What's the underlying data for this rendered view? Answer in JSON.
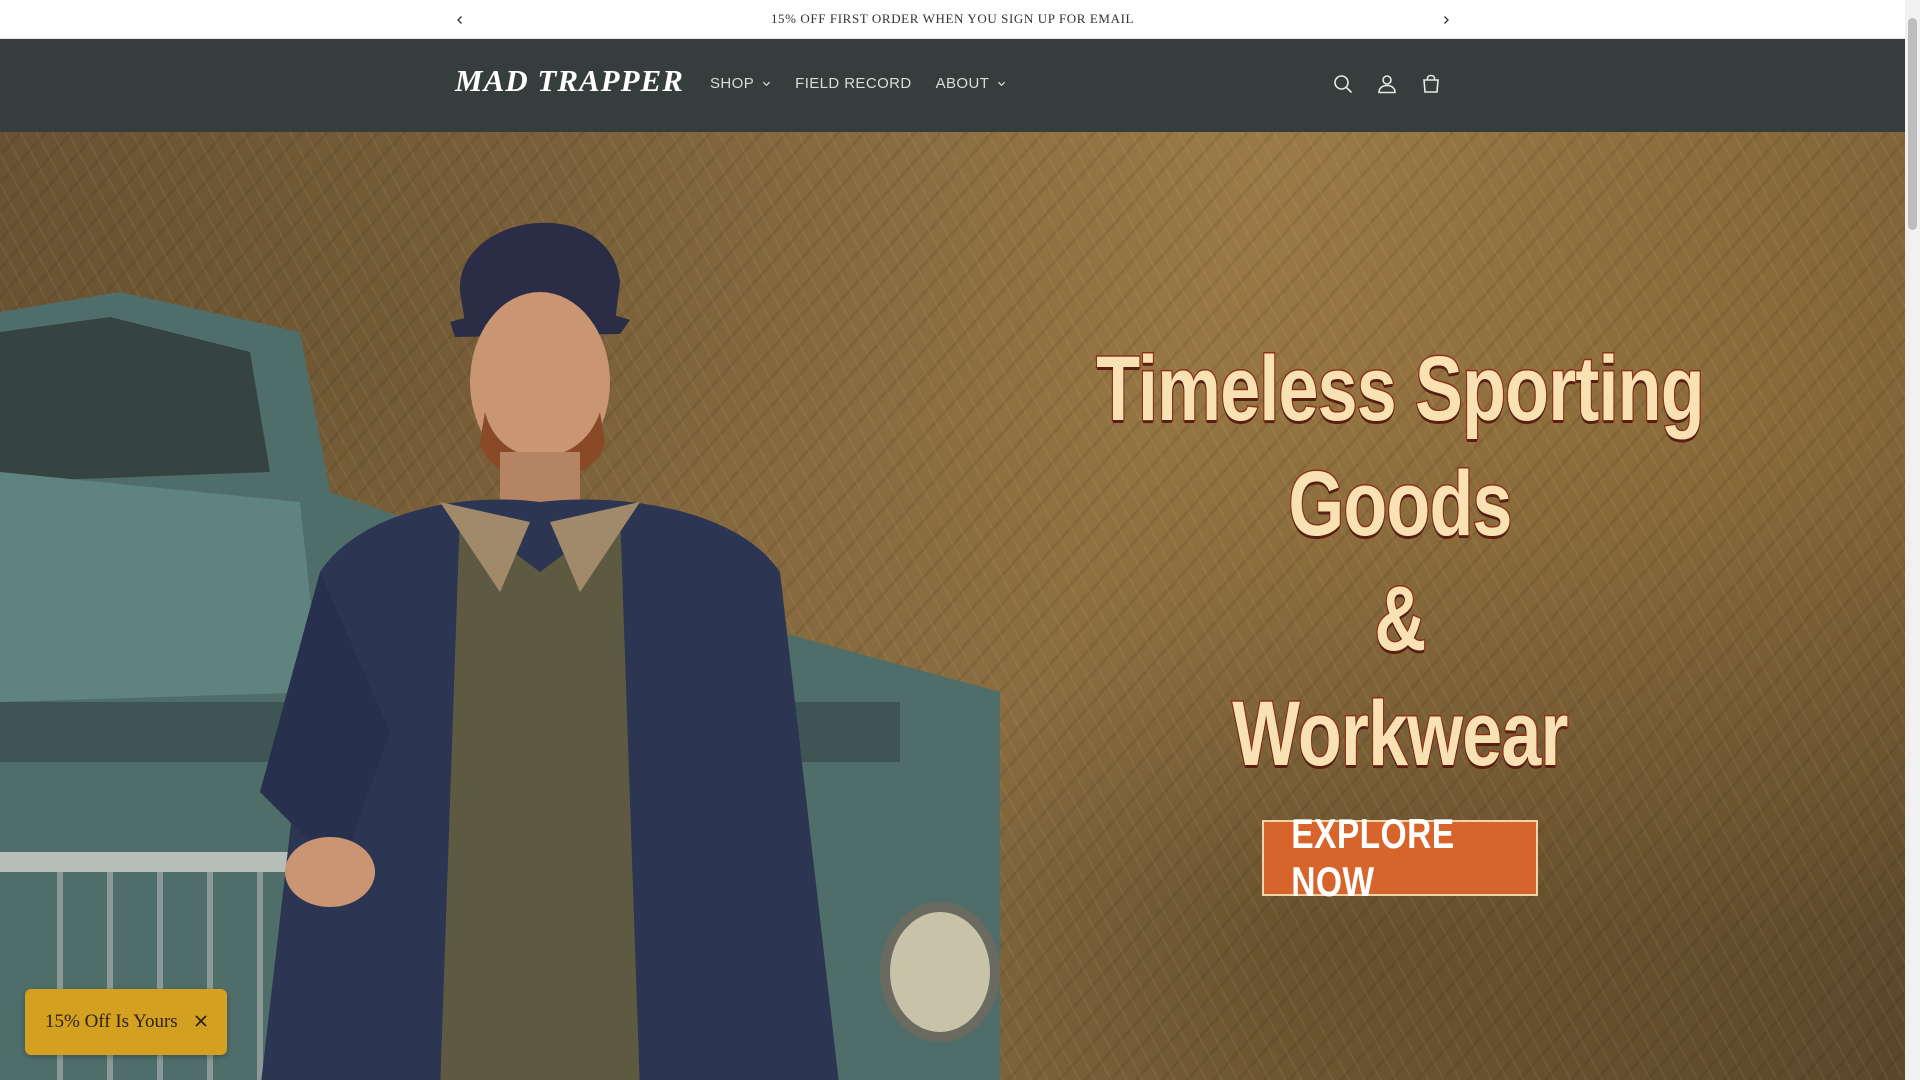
{
  "announcement": {
    "text": "15% OFF FIRST ORDER WHEN YOU SIGN UP FOR EMAIL",
    "prev_icon": "chevron-left-icon",
    "next_icon": "chevron-right-icon"
  },
  "header": {
    "logo": "MAD TRAPPER",
    "nav": [
      {
        "label": "SHOP",
        "has_dropdown": true
      },
      {
        "label": "FIELD RECORD",
        "has_dropdown": false
      },
      {
        "label": "ABOUT",
        "has_dropdown": true
      }
    ],
    "icons": [
      "search-icon",
      "account-icon",
      "cart-icon"
    ]
  },
  "hero": {
    "headline_lines": [
      "Timeless Sporting Goods",
      "&",
      "Workwear"
    ],
    "cta_label": "EXPLORE NOW"
  },
  "promo": {
    "label": "15% Off Is Yours",
    "close_icon": "close-icon"
  },
  "colors": {
    "header_bg": "#363e3d",
    "cta_bg": "#d7642a",
    "promo_bg": "#d4a01f",
    "headline_fill": "#f8e2b4",
    "headline_stroke": "#8f2f17"
  }
}
